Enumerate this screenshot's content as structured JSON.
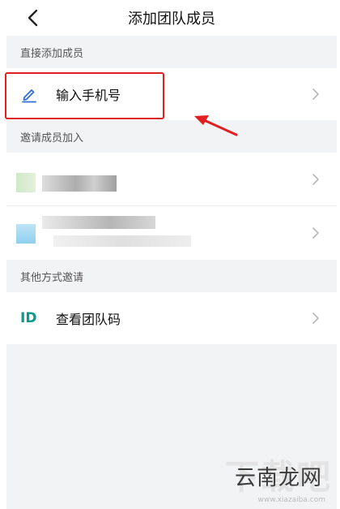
{
  "navbar": {
    "title": "添加团队成员",
    "back_icon": "chevron-left-icon"
  },
  "sections": {
    "direct": {
      "header": "直接添加成员",
      "phone_label": "输入手机号",
      "phone_icon": "pencil-icon"
    },
    "invite": {
      "header": "邀请成员加入"
    },
    "other": {
      "header": "其他方式邀请",
      "id_badge": "ID",
      "code_label": "查看团队码"
    }
  },
  "watermark": {
    "bg_text": "下载吧",
    "text": "云南龙网",
    "url": "www.xiazaiba.com"
  },
  "colors": {
    "accent_teal": "#0a9a8e",
    "highlight_red": "#e02020",
    "pencil_blue": "#2f6fd6"
  }
}
